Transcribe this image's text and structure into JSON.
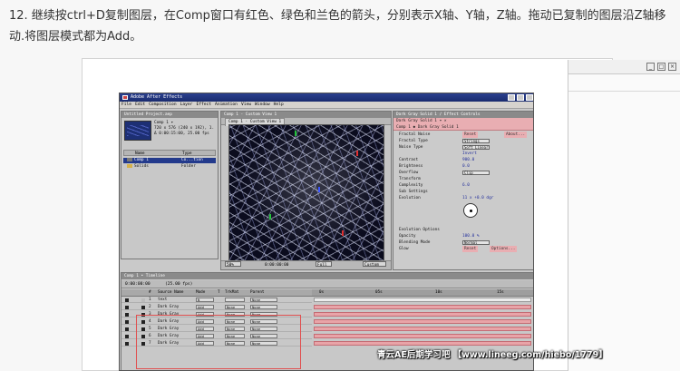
{
  "instruction": "12. 继续按ctrl+D复制图层，在Comp窗口有红色、绿色和兰色的箭头，分别表示X轴、Y轴，Z轴。拖动已复制的图层沿Z轴移动.将图层模式都为Add。",
  "background_window": {
    "buttons": [
      "_",
      "□",
      "×"
    ]
  },
  "ae": {
    "title": "Adobe After Effects",
    "menu": [
      "File",
      "Edit",
      "Composition",
      "Layer",
      "Effect",
      "Animation",
      "View",
      "Window",
      "Help"
    ],
    "project": {
      "title": "Untitled Project.aep",
      "info": [
        "Comp 1 ▾",
        "720 x 576  (240 x 192), 1.",
        "Δ 0:00:15:00, 25.00 fps"
      ],
      "columns": [
        "Name",
        "Type"
      ],
      "items": [
        {
          "name": "Comp 1",
          "type": "Co...tion",
          "selected": true
        },
        {
          "name": "Solids",
          "type": "Folder",
          "selected": false
        }
      ]
    },
    "comp": {
      "title": "Comp 1 - Custom View 1",
      "tab": "Comp 1 · Custom View 1",
      "footer": {
        "zoom": "50%",
        "timecode": "0:00:00:00",
        "resolution": "Full",
        "view": "Custom"
      }
    },
    "effects": {
      "title": "Dark Gray Solid 1 / Effect Controls",
      "header_line1": "Dark Gray Solid 1 ▾ ✕",
      "header_line2": "Comp 1 ◆ Dark Gray Solid 1",
      "fx_name": "Fractal Noise",
      "reset": "Reset",
      "about": "About...",
      "props": [
        {
          "label": "Fractal Type",
          "value": "Strings",
          "kind": "dropdown"
        },
        {
          "label": "Noise Type",
          "value": "Soft Linear",
          "kind": "dropdown"
        },
        {
          "label": "",
          "value": "Invert",
          "kind": "check"
        },
        {
          "label": "Contrast",
          "value": "900.0",
          "kind": "value"
        },
        {
          "label": "Brightness",
          "value": "0.0",
          "kind": "value"
        },
        {
          "label": "Overflow",
          "value": "Clip",
          "kind": "dropdown"
        },
        {
          "label": "Transform",
          "value": "",
          "kind": "group"
        },
        {
          "label": "Complexity",
          "value": "6.0",
          "kind": "value"
        },
        {
          "label": "Sub Settings",
          "value": "",
          "kind": "group"
        },
        {
          "label": "Evolution",
          "value": "11 x +0.0 dgr",
          "kind": "value"
        }
      ],
      "props2": [
        {
          "label": "Evolution Options",
          "value": "",
          "kind": "group"
        },
        {
          "label": "Opacity",
          "value": "100.0 %",
          "kind": "value"
        },
        {
          "label": "Blending Mode",
          "value": "Normal",
          "kind": "dropdown"
        }
      ],
      "glow": {
        "label": "Glow",
        "reset": "Reset",
        "options": "Options...",
        "about": "About..."
      }
    },
    "timeline": {
      "title": "Comp 1 • Timeline",
      "time": "0:00:00:00",
      "fps": "(25.00 fps)",
      "columns": [
        "#",
        "Source Name",
        "Mode",
        "T",
        "TrkMat",
        "Parent"
      ],
      "ruler": [
        "0s",
        "05s",
        "10s",
        "15s"
      ],
      "layers": [
        {
          "num": "1",
          "name": "text",
          "mode": "N",
          "trkmat": "",
          "parent": "None",
          "color": "#bbbbbb",
          "is_text": true
        },
        {
          "num": "2",
          "name": "Dark Gray",
          "mode": "Add",
          "trkmat": "None",
          "parent": "None",
          "color": "#222222",
          "is_text": false
        },
        {
          "num": "3",
          "name": "Dark Gray",
          "mode": "Add",
          "trkmat": "None",
          "parent": "None",
          "color": "#222222",
          "is_text": false
        },
        {
          "num": "4",
          "name": "Dark Gray",
          "mode": "Add",
          "trkmat": "None",
          "parent": "None",
          "color": "#222222",
          "is_text": false
        },
        {
          "num": "5",
          "name": "Dark Gray",
          "mode": "Add",
          "trkmat": "None",
          "parent": "None",
          "color": "#222222",
          "is_text": false
        },
        {
          "num": "6",
          "name": "Dark Gray",
          "mode": "Add",
          "trkmat": "None",
          "parent": "None",
          "color": "#222222",
          "is_text": false
        },
        {
          "num": "7",
          "name": "Dark Gray",
          "mode": "Add",
          "trkmat": "None",
          "parent": "None",
          "color": "#222222",
          "is_text": false
        }
      ]
    }
  },
  "watermark": "青云AE后期学习吧  【www.lineeg.com/hiebo/1779】",
  "colors": {
    "highlight_red": "#e05050",
    "layer_bar": "#e8a4a8",
    "titlebar_blue": "#1a2c6e"
  }
}
